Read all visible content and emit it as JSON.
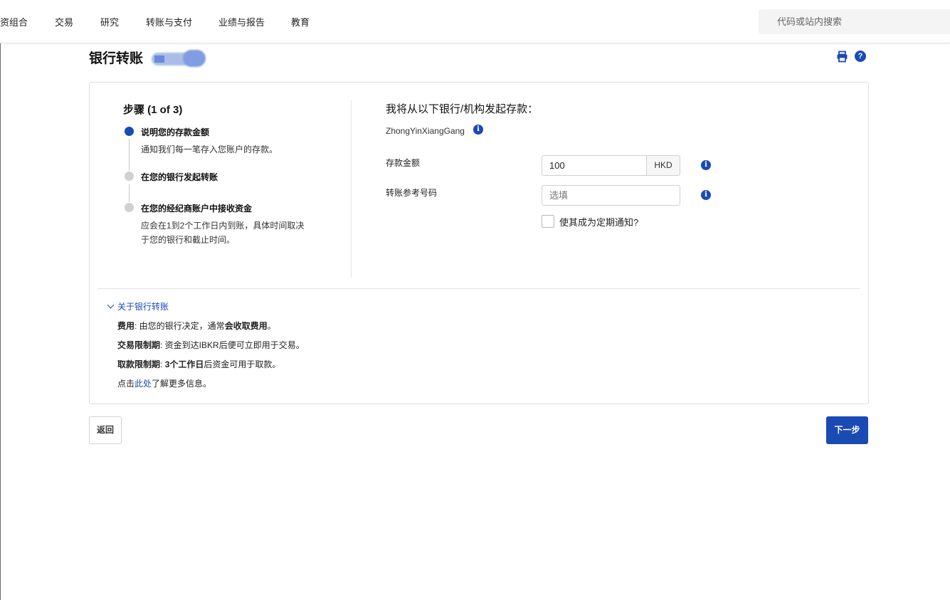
{
  "nav": {
    "items": [
      "资组合",
      "交易",
      "研究",
      "转账与支付",
      "业绩与报告",
      "教育"
    ],
    "search_placeholder": "代码或站内搜索"
  },
  "page": {
    "title": "银行转账"
  },
  "steps": {
    "title": "步骤 (1 of 3)",
    "items": [
      {
        "label": "说明您的存款金额",
        "desc": "通知我们每一笔存入您账户的存款。",
        "active": true
      },
      {
        "label": "在您的银行发起转账",
        "desc": "",
        "active": false
      },
      {
        "label": "在您的经纪商账户中接收资金",
        "desc": "应会在1到2个工作日内到账，具体时间取决于您的银行和截止时间。",
        "active": false
      }
    ]
  },
  "form": {
    "title": "我将从以下银行/机构发起存款：",
    "bank_name": "ZhongYinXiangGang",
    "amount_label": "存款金额",
    "amount_value": "100",
    "currency": "HKD",
    "reference_label": "转账参考号码",
    "reference_placeholder": "选填",
    "recurring_label": "使其成为定期通知?"
  },
  "about": {
    "toggle_label": "关于银行转账",
    "fee_label": "费用",
    "fee_text_1": ": 由您的银行决定，通常",
    "fee_text_bold": "会收取费用",
    "fee_text_2": "。",
    "trade_label": "交易限制期",
    "trade_text": ": 资金到达IBKR后便可立即用于交易。",
    "withdraw_label": "取款限制期",
    "withdraw_text_1": ": ",
    "withdraw_text_bold": "3个工作日",
    "withdraw_text_2": "后资金可用于取款。",
    "more_prefix": "点击",
    "more_link": "此处",
    "more_suffix": "了解更多信息。"
  },
  "buttons": {
    "back": "返回",
    "next": "下一步"
  },
  "colors": {
    "accent": "#1a4ab4",
    "border": "#dedede"
  },
  "icons": [
    "print-icon",
    "help-icon",
    "info-icon",
    "chevron-down-icon"
  ]
}
